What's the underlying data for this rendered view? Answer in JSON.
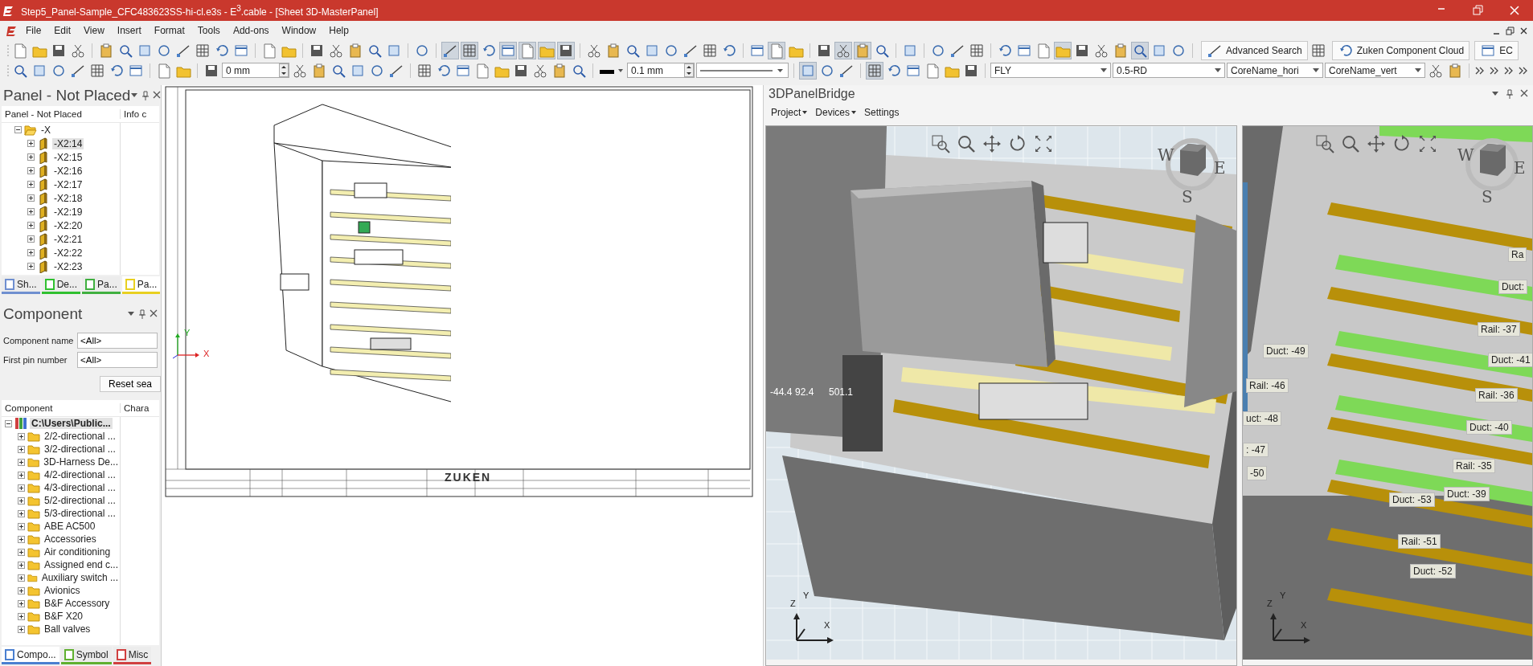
{
  "window": {
    "title": "Step5_Panel-Sample_CFC483623SS-hi-cl.e3s - E$^{3}$.cable - [Sheet 3D-MasterPanel]"
  },
  "menu": [
    "File",
    "Edit",
    "View",
    "Insert",
    "Format",
    "Tools",
    "Add-ons",
    "Window",
    "Help"
  ],
  "toolbar_1": [
    {
      "kind": "button",
      "on": false
    },
    {
      "kind": "button",
      "on": false
    },
    {
      "kind": "button",
      "on": false
    },
    {
      "kind": "button",
      "on": false
    },
    {
      "kind": "separator"
    },
    {
      "kind": "button",
      "on": false
    },
    {
      "kind": "button",
      "on": false
    },
    {
      "kind": "button",
      "on": false
    },
    {
      "kind": "button",
      "on": false
    },
    {
      "kind": "button",
      "on": false
    },
    {
      "kind": "button",
      "on": false
    },
    {
      "kind": "button",
      "on": false
    },
    {
      "kind": "button",
      "on": false
    },
    {
      "kind": "separator"
    },
    {
      "kind": "button",
      "on": false
    },
    {
      "kind": "button",
      "on": false
    },
    {
      "kind": "separator"
    },
    {
      "kind": "button",
      "on": false
    },
    {
      "kind": "button",
      "on": false
    },
    {
      "kind": "button",
      "on": false
    },
    {
      "kind": "button",
      "on": false
    },
    {
      "kind": "button",
      "on": false
    },
    {
      "kind": "separator"
    },
    {
      "kind": "button",
      "on": false
    },
    {
      "kind": "separator"
    },
    {
      "kind": "button",
      "on": true
    },
    {
      "kind": "button",
      "on": true
    },
    {
      "kind": "button",
      "on": false
    },
    {
      "kind": "button",
      "on": true
    },
    {
      "kind": "button",
      "on": true
    },
    {
      "kind": "button",
      "on": true
    },
    {
      "kind": "button",
      "on": true
    },
    {
      "kind": "separator"
    },
    {
      "kind": "button",
      "on": false
    },
    {
      "kind": "button",
      "on": false
    },
    {
      "kind": "button",
      "on": false
    },
    {
      "kind": "button",
      "on": false
    },
    {
      "kind": "button",
      "on": false
    },
    {
      "kind": "button",
      "on": false
    },
    {
      "kind": "button",
      "on": false
    },
    {
      "kind": "button",
      "on": false
    },
    {
      "kind": "separator"
    },
    {
      "kind": "button",
      "on": false
    },
    {
      "kind": "button",
      "on": true
    },
    {
      "kind": "button",
      "on": false
    },
    {
      "kind": "separator"
    },
    {
      "kind": "button",
      "on": false
    },
    {
      "kind": "button",
      "on": true
    },
    {
      "kind": "button",
      "on": true
    },
    {
      "kind": "button",
      "on": false
    },
    {
      "kind": "separator"
    },
    {
      "kind": "button",
      "on": false
    },
    {
      "kind": "separator"
    },
    {
      "kind": "button",
      "on": false
    },
    {
      "kind": "button",
      "on": false
    },
    {
      "kind": "button",
      "on": false
    },
    {
      "kind": "separator"
    },
    {
      "kind": "button",
      "on": false
    },
    {
      "kind": "button",
      "on": false
    },
    {
      "kind": "button",
      "on": false
    },
    {
      "kind": "button",
      "on": true
    },
    {
      "kind": "button",
      "on": false
    },
    {
      "kind": "button",
      "on": false
    },
    {
      "kind": "button",
      "on": false
    },
    {
      "kind": "button",
      "on": true
    },
    {
      "kind": "button",
      "on": false
    },
    {
      "kind": "button",
      "on": false
    },
    {
      "kind": "separator"
    },
    {
      "kind": "text_button",
      "label": "Advanced Search"
    },
    {
      "kind": "button",
      "on": false
    },
    {
      "kind": "text_button",
      "label": "Zuken Component Cloud"
    },
    {
      "kind": "text_button",
      "label": "EC"
    }
  ],
  "toolbar_2": [
    {
      "kind": "button",
      "on": false
    },
    {
      "kind": "button",
      "on": false
    },
    {
      "kind": "button",
      "on": false
    },
    {
      "kind": "button",
      "on": false
    },
    {
      "kind": "button",
      "on": false
    },
    {
      "kind": "button",
      "on": false
    },
    {
      "kind": "button",
      "on": false
    },
    {
      "kind": "separator"
    },
    {
      "kind": "button",
      "on": false
    },
    {
      "kind": "button",
      "on": false
    },
    {
      "kind": "separator"
    },
    {
      "kind": "button",
      "on": false
    },
    {
      "kind": "spin",
      "value": "0 mm"
    },
    {
      "kind": "button",
      "on": false
    },
    {
      "kind": "button",
      "on": false
    },
    {
      "kind": "button",
      "on": false
    },
    {
      "kind": "button",
      "on": false
    },
    {
      "kind": "button",
      "on": false
    },
    {
      "kind": "button",
      "on": false
    },
    {
      "kind": "separator"
    },
    {
      "kind": "button",
      "on": false
    },
    {
      "kind": "button",
      "on": false
    },
    {
      "kind": "button",
      "on": false
    },
    {
      "kind": "button",
      "on": false
    },
    {
      "kind": "button",
      "on": false
    },
    {
      "kind": "button",
      "on": false
    },
    {
      "kind": "button",
      "on": false
    },
    {
      "kind": "button",
      "on": false
    },
    {
      "kind": "button",
      "on": false
    },
    {
      "kind": "separator"
    },
    {
      "kind": "color"
    },
    {
      "kind": "spin",
      "value": "0.1 mm"
    },
    {
      "kind": "linestyle"
    },
    {
      "kind": "separator"
    },
    {
      "kind": "button",
      "on": true
    },
    {
      "kind": "button",
      "on": false
    },
    {
      "kind": "button",
      "on": false
    },
    {
      "kind": "separator"
    },
    {
      "kind": "button",
      "on": true
    },
    {
      "kind": "button",
      "on": false
    },
    {
      "kind": "button",
      "on": false
    },
    {
      "kind": "button",
      "on": false
    },
    {
      "kind": "button",
      "on": false
    },
    {
      "kind": "button",
      "on": false
    },
    {
      "kind": "separator"
    },
    {
      "kind": "combo",
      "value": "FLY"
    },
    {
      "kind": "combo",
      "value": "0.5-RD"
    },
    {
      "kind": "combo",
      "value": "CoreName_hori"
    },
    {
      "kind": "combo",
      "value": "CoreName_vert"
    },
    {
      "kind": "button",
      "on": false
    },
    {
      "kind": "button",
      "on": false
    },
    {
      "kind": "separator"
    },
    {
      "kind": "chevron"
    },
    {
      "kind": "chevron"
    },
    {
      "kind": "chevron"
    },
    {
      "kind": "chevron"
    }
  ],
  "panel_not_placed": {
    "title": "Panel - Not Placed",
    "columns": [
      "Panel - Not Placed",
      "Info c"
    ],
    "tree": [
      {
        "label": "-X",
        "expanded": true,
        "selected": false,
        "children": [
          {
            "label": "-X2:14",
            "expanded": false,
            "selected": true
          },
          {
            "label": "-X2:15",
            "expanded": false,
            "selected": false
          },
          {
            "label": "-X2:16",
            "expanded": false,
            "selected": false
          },
          {
            "label": "-X2:17",
            "expanded": false,
            "selected": false
          },
          {
            "label": "-X2:18",
            "expanded": false,
            "selected": false
          },
          {
            "label": "-X2:19",
            "expanded": false,
            "selected": false
          },
          {
            "label": "-X2:20",
            "expanded": false,
            "selected": false
          },
          {
            "label": "-X2:21",
            "expanded": false,
            "selected": false
          },
          {
            "label": "-X2:22",
            "expanded": false,
            "selected": false
          },
          {
            "label": "-X2:23",
            "expanded": false,
            "selected": false
          }
        ]
      }
    ],
    "tabs": [
      {
        "label": "Sh...",
        "selected": false,
        "color": "#6f8fd0"
      },
      {
        "label": "De...",
        "selected": false,
        "color": "#30c030"
      },
      {
        "label": "Pa...",
        "selected": false,
        "color": "#40b040"
      },
      {
        "label": "Pa...",
        "selected": true,
        "color": "#e8d020"
      }
    ]
  },
  "component_panel": {
    "title": "Component",
    "fields": [
      {
        "label": "Component name",
        "value": "<All>"
      },
      {
        "label": "First pin number",
        "value": "<All>"
      }
    ],
    "reset_button": "Reset sea",
    "columns": [
      "Component",
      "Chara"
    ],
    "tree": [
      {
        "label": "C:\\Users\\Public...",
        "expanded": true,
        "selected": true,
        "children": [
          {
            "label": "2/2-directional ...",
            "expanded": false,
            "selected": false
          },
          {
            "label": "3/2-directional ...",
            "expanded": false,
            "selected": false
          },
          {
            "label": "3D-Harness De...",
            "expanded": false,
            "selected": false
          },
          {
            "label": "4/2-directional ...",
            "expanded": false,
            "selected": false
          },
          {
            "label": "4/3-directional ...",
            "expanded": false,
            "selected": false
          },
          {
            "label": "5/2-directional ...",
            "expanded": false,
            "selected": false
          },
          {
            "label": "5/3-directional ...",
            "expanded": false,
            "selected": false
          },
          {
            "label": "ABE AC500",
            "expanded": false,
            "selected": false
          },
          {
            "label": "Accessories",
            "expanded": false,
            "selected": false
          },
          {
            "label": "Air conditioning",
            "expanded": false,
            "selected": false
          },
          {
            "label": "Assigned end c...",
            "expanded": false,
            "selected": false
          },
          {
            "label": "Auxiliary switch ...",
            "expanded": false,
            "selected": false
          },
          {
            "label": "Avionics",
            "expanded": false,
            "selected": false
          },
          {
            "label": "B&F Accessory",
            "expanded": false,
            "selected": false
          },
          {
            "label": "B&F X20",
            "expanded": false,
            "selected": false
          },
          {
            "label": "Ball valves",
            "expanded": false,
            "selected": false
          }
        ]
      }
    ],
    "tabs": [
      {
        "label": "Compo...",
        "selected": true,
        "color": "#4a7fd0"
      },
      {
        "label": "Symbol",
        "selected": false,
        "color": "#60b030"
      },
      {
        "label": "Misc",
        "selected": false,
        "color": "#d04040"
      }
    ]
  },
  "drawing_sheet": {
    "logo": "ZUKEN",
    "axis_labels": [
      "Y",
      "X"
    ]
  },
  "panel_bridge": {
    "title": "3DPanelBridge",
    "menu": [
      {
        "label": "Project",
        "dropdown": true
      },
      {
        "label": "Devices",
        "dropdown": true
      },
      {
        "label": "Settings",
        "dropdown": false
      }
    ],
    "viewports": [
      {
        "kind": "cabinet",
        "compass": [
          "W",
          "E",
          "S"
        ],
        "axes": [
          "Z",
          "Y",
          "X"
        ],
        "readout": [
          "-44.4",
          "92.4",
          "501.1"
        ]
      },
      {
        "kind": "rails",
        "compass": [
          "W",
          "E",
          "S"
        ],
        "axes": [
          "Z",
          "Y",
          "X"
        ],
        "labels": [
          "Ra",
          "Duct:",
          "Rail: -37",
          "Duct: -49",
          "Duct: -41",
          "Rail: -46",
          "Rail: -36",
          "uct: -48",
          "Duct: -40",
          ": -47",
          "-50",
          "Rail: -35",
          "Duct: -39",
          "Duct: -53",
          "Rail: -51",
          "Duct: -52"
        ]
      }
    ]
  }
}
